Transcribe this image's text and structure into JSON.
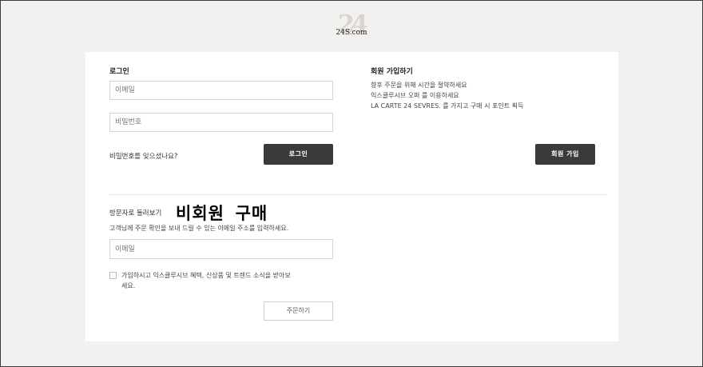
{
  "brand": {
    "monogram": "24",
    "wordmark": "24S.com"
  },
  "login": {
    "heading": "로그인",
    "email_placeholder": "이메일",
    "password_placeholder": "비밀번호",
    "forgot_link": "비밀번호를 잊으셨나요?",
    "submit_label": "로그인"
  },
  "signup": {
    "heading": "회원 가입하기",
    "benefits": [
      "향후 주문을 위해 시간을 절약하세요",
      "익스클루시브 오퍼 를 이용하세요",
      "LA CARTE 24 SEVRES. 를 가지고 구매 시 포인트 획득"
    ],
    "submit_label": "회원 가입"
  },
  "guest": {
    "heading": "방문자로 둘러보기",
    "overlay_title": "비회원 구매",
    "description": "고객님께 주문 확인을 보내 드릴 수 있는 이메일 주소를 입력하세요.",
    "email_placeholder": "이메일",
    "newsletter_label_line1": "가입하시고 익스클루시브 혜택, 신상품 및 트렌드 소식을 받아보",
    "newsletter_label_line2": "세요.",
    "newsletter_checked": false,
    "submit_label": "주문하기"
  }
}
